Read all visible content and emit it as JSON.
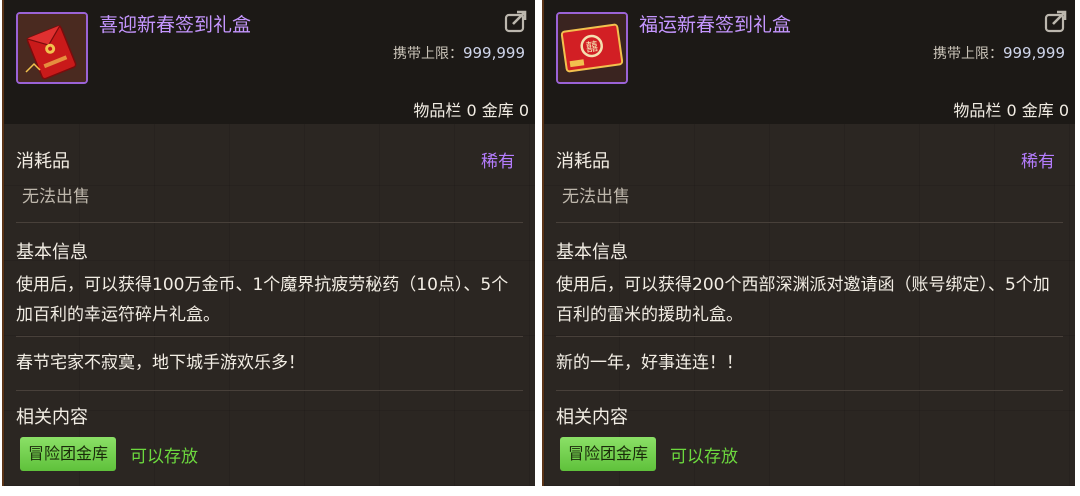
{
  "items": [
    {
      "title": "喜迎新春签到礼盒",
      "limit_label": "携带上限：",
      "limit_value": "999,999",
      "stock": "物品栏 0 金库 0",
      "category": "消耗品",
      "rarity": "稀有",
      "sell": "无法出售",
      "basic_heading": "基本信息",
      "description": "使用后，可以获得100万金币、1个魔界抗疲劳秘药（10点）、5个加百利的幸运符碎片礼盒。",
      "flavor": "春节宅家不寂寞，地下城手游欢乐多！",
      "related_heading": "相关内容",
      "storage_tag": "冒险团金库",
      "storable": "可以存放",
      "icon": "red-envelope-icon",
      "rarity_color": "#b57dff"
    },
    {
      "title": "福运新春签到礼盒",
      "limit_label": "携带上限：",
      "limit_value": "999,999",
      "stock": "物品栏 0 金库 0",
      "category": "消耗品",
      "rarity": "稀有",
      "sell": "无法出售",
      "basic_heading": "基本信息",
      "description": "使用后，可以获得200个西部深渊派对邀请函（账号绑定）、5个加百利的雷米的援助礼盒。",
      "flavor": "新的一年，好事连连！！",
      "related_heading": "相关内容",
      "storage_tag": "冒险团金库",
      "storable": "可以存放",
      "icon": "red-gift-box-icon",
      "rarity_color": "#b57dff"
    }
  ]
}
